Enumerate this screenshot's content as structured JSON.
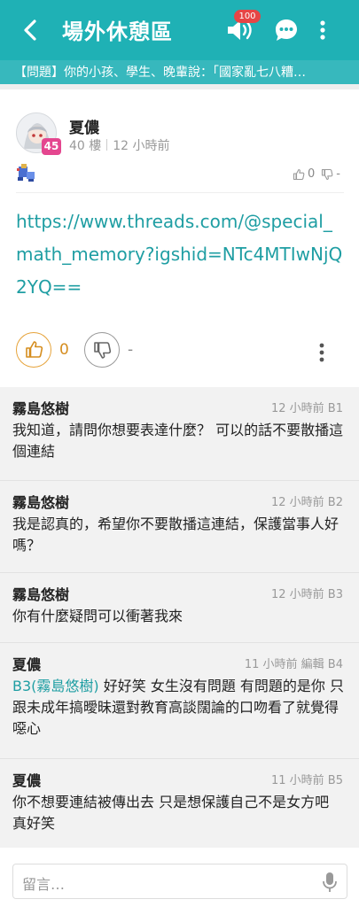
{
  "appbar": {
    "title": "場外休憩區",
    "notification_count": "100"
  },
  "topic": {
    "text": "【問題】你的小孩、學生、晚輩說：「國家亂七八糟…"
  },
  "post": {
    "author": "夏儂",
    "level": "45",
    "floor": "40 樓",
    "time": "12 小時前",
    "mini_gp": "0",
    "mini_bp": "-",
    "link": "https://www.threads.com/@special_math_memory?igshid=NTc4MTIwNjQ2YQ==",
    "gp_count": "0",
    "bp_count": "-"
  },
  "comments": [
    {
      "author": "霧島悠樹",
      "meta": "12 小時前  B1",
      "text": "我知道，請問你想要表達什麼？ 可以的話不要散播這個連結"
    },
    {
      "author": "霧島悠樹",
      "meta": "12 小時前  B2",
      "text": "我是認真的，希望你不要散播這連結，保護當事人好嗎？"
    },
    {
      "author": "霧島悠樹",
      "meta": "12 小時前  B3",
      "text": "你有什麼疑問可以衝著我來"
    },
    {
      "author": "夏儂",
      "meta": "11 小時前 編輯  B4",
      "mention": "B3(霧島悠樹)",
      "text": " 好好笑 女生沒有問題 有問題的是你 只跟未成年搞曖昧還對教育高談闊論的口吻看了就覺得噁心"
    },
    {
      "author": "夏儂",
      "meta": "11 小時前  B5",
      "text": "你不想要連結被傳出去 只是想保護自己不是女方吧 真好笑"
    }
  ],
  "reply": {
    "placeholder": "留言…"
  },
  "colors": {
    "brand": "#1fb1b5",
    "link": "#1f9ea3",
    "gp": "#e6a33a",
    "badge": "#e64545"
  },
  "icons": [
    "back-icon",
    "speaker-icon",
    "chat-bubble-icon",
    "more-vertical-icon",
    "thumb-up-icon",
    "thumb-down-icon",
    "microphone-icon"
  ]
}
